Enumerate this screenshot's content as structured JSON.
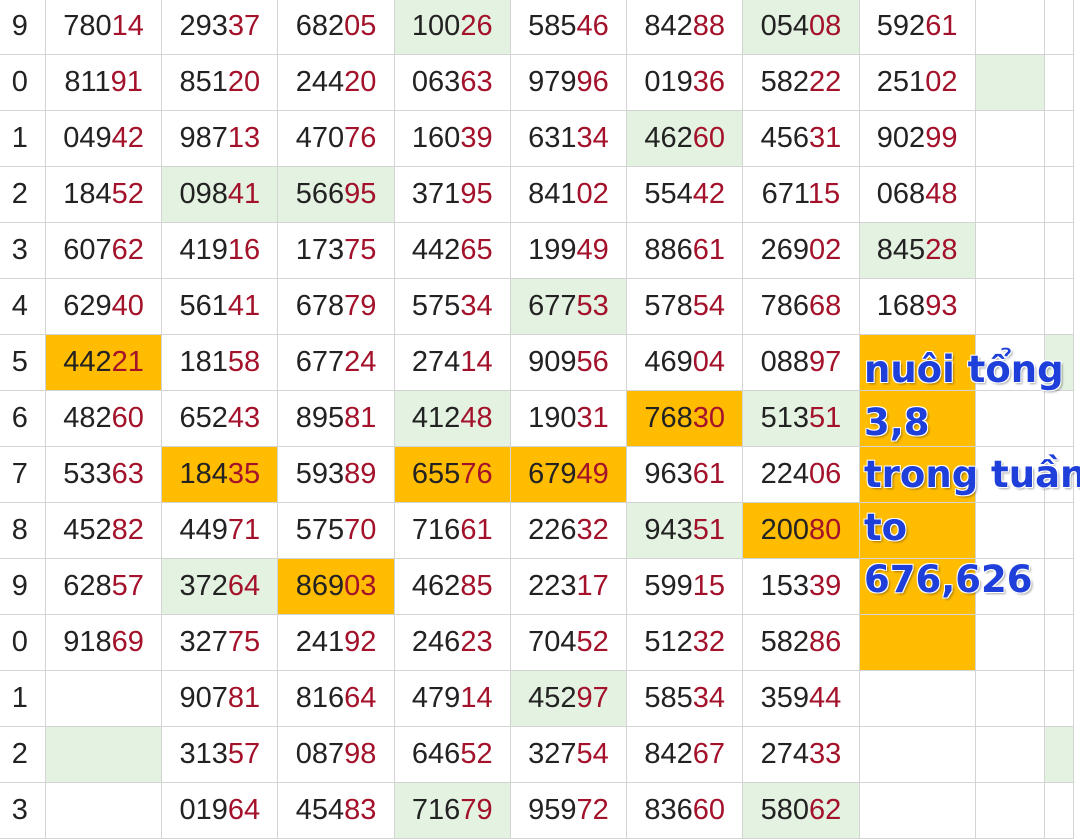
{
  "row_labels": [
    "9",
    "0",
    "1",
    "2",
    "3",
    "4",
    "5",
    "6",
    "7",
    "8",
    "9",
    "0",
    "1",
    "2",
    "3"
  ],
  "rows": [
    [
      [
        "780",
        "14"
      ],
      [
        "293",
        "37"
      ],
      [
        "682",
        "05"
      ],
      [
        "100",
        "26"
      ],
      [
        "585",
        "46"
      ],
      [
        "842",
        "88"
      ],
      [
        "054",
        "08"
      ],
      [
        "592",
        "61"
      ],
      [
        "",
        ""
      ],
      [
        "",
        ""
      ]
    ],
    [
      [
        "811",
        "91"
      ],
      [
        "851",
        "20"
      ],
      [
        "244",
        "20"
      ],
      [
        "063",
        "63"
      ],
      [
        "979",
        "96"
      ],
      [
        "019",
        "36"
      ],
      [
        "582",
        "22"
      ],
      [
        "251",
        "02"
      ],
      [
        "",
        ""
      ],
      [
        "",
        ""
      ]
    ],
    [
      [
        "049",
        "42"
      ],
      [
        "987",
        "13"
      ],
      [
        "470",
        "76"
      ],
      [
        "160",
        "39"
      ],
      [
        "631",
        "34"
      ],
      [
        "462",
        "60"
      ],
      [
        "456",
        "31"
      ],
      [
        "902",
        "99"
      ],
      [
        "",
        ""
      ],
      [
        "",
        ""
      ]
    ],
    [
      [
        "184",
        "52"
      ],
      [
        "098",
        "41"
      ],
      [
        "566",
        "95"
      ],
      [
        "371",
        "95"
      ],
      [
        "841",
        "02"
      ],
      [
        "554",
        "42"
      ],
      [
        "671",
        "15"
      ],
      [
        "068",
        "48"
      ],
      [
        "",
        ""
      ],
      [
        "",
        ""
      ]
    ],
    [
      [
        "607",
        "62"
      ],
      [
        "419",
        "16"
      ],
      [
        "173",
        "75"
      ],
      [
        "442",
        "65"
      ],
      [
        "199",
        "49"
      ],
      [
        "886",
        "61"
      ],
      [
        "269",
        "02"
      ],
      [
        "845",
        "28"
      ],
      [
        "",
        ""
      ],
      [
        "",
        ""
      ]
    ],
    [
      [
        "629",
        "40"
      ],
      [
        "561",
        "41"
      ],
      [
        "678",
        "79"
      ],
      [
        "575",
        "34"
      ],
      [
        "677",
        "53"
      ],
      [
        "578",
        "54"
      ],
      [
        "786",
        "68"
      ],
      [
        "168",
        "93"
      ],
      [
        "",
        ""
      ],
      [
        "",
        ""
      ]
    ],
    [
      [
        "442",
        "21"
      ],
      [
        "181",
        "58"
      ],
      [
        "677",
        "24"
      ],
      [
        "274",
        "14"
      ],
      [
        "909",
        "56"
      ],
      [
        "469",
        "04"
      ],
      [
        "088",
        "97"
      ],
      [
        "",
        ""
      ],
      [
        "",
        ""
      ],
      [
        "",
        ""
      ]
    ],
    [
      [
        "482",
        "60"
      ],
      [
        "652",
        "43"
      ],
      [
        "895",
        "81"
      ],
      [
        "412",
        "48"
      ],
      [
        "190",
        "31"
      ],
      [
        "768",
        "30"
      ],
      [
        "513",
        "51"
      ],
      [
        "",
        ""
      ],
      [
        "",
        ""
      ],
      [
        "",
        ""
      ]
    ],
    [
      [
        "533",
        "63"
      ],
      [
        "184",
        "35"
      ],
      [
        "593",
        "89"
      ],
      [
        "655",
        "76"
      ],
      [
        "679",
        "49"
      ],
      [
        "963",
        "61"
      ],
      [
        "224",
        "06"
      ],
      [
        "",
        ""
      ],
      [
        "",
        ""
      ],
      [
        "",
        ""
      ]
    ],
    [
      [
        "452",
        "82"
      ],
      [
        "449",
        "71"
      ],
      [
        "575",
        "70"
      ],
      [
        "716",
        "61"
      ],
      [
        "226",
        "32"
      ],
      [
        "943",
        "51"
      ],
      [
        "200",
        "80"
      ],
      [
        "",
        ""
      ],
      [
        "",
        ""
      ],
      [
        "",
        ""
      ]
    ],
    [
      [
        "628",
        "57"
      ],
      [
        "372",
        "64"
      ],
      [
        "869",
        "03"
      ],
      [
        "462",
        "85"
      ],
      [
        "223",
        "17"
      ],
      [
        "599",
        "15"
      ],
      [
        "153",
        "39"
      ],
      [
        "",
        ""
      ],
      [
        "",
        ""
      ],
      [
        "",
        ""
      ]
    ],
    [
      [
        "918",
        "69"
      ],
      [
        "327",
        "75"
      ],
      [
        "241",
        "92"
      ],
      [
        "246",
        "23"
      ],
      [
        "704",
        "52"
      ],
      [
        "512",
        "32"
      ],
      [
        "582",
        "86"
      ],
      [
        "",
        ""
      ],
      [
        "",
        ""
      ],
      [
        "",
        ""
      ]
    ],
    [
      [
        "",
        ""
      ],
      [
        "907",
        "81"
      ],
      [
        "816",
        "64"
      ],
      [
        "479",
        "14"
      ],
      [
        "452",
        "97"
      ],
      [
        "585",
        "34"
      ],
      [
        "359",
        "44"
      ],
      [
        "",
        ""
      ],
      [
        "",
        ""
      ],
      [
        "",
        ""
      ]
    ],
    [
      [
        "",
        ""
      ],
      [
        "313",
        "57"
      ],
      [
        "087",
        "98"
      ],
      [
        "646",
        "52"
      ],
      [
        "327",
        "54"
      ],
      [
        "842",
        "67"
      ],
      [
        "274",
        "33"
      ],
      [
        "",
        ""
      ],
      [
        "",
        ""
      ],
      [
        "",
        ""
      ]
    ],
    [
      [
        "",
        ""
      ],
      [
        "019",
        "64"
      ],
      [
        "454",
        "83"
      ],
      [
        "716",
        "79"
      ],
      [
        "959",
        "72"
      ],
      [
        "836",
        "60"
      ],
      [
        "580",
        "62"
      ],
      [
        "",
        ""
      ],
      [
        "",
        ""
      ],
      [
        "",
        ""
      ]
    ]
  ],
  "highlights": {
    "light_green": [
      "0-3",
      "0-6",
      "1-8",
      "2-5",
      "3-1",
      "3-2",
      "4-7",
      "5-4",
      "6-9",
      "7-3",
      "7-6",
      "9-5",
      "10-1",
      "12-4",
      "13-0",
      "13-9",
      "14-3",
      "14-6"
    ],
    "orange": [
      "6-0",
      "7-5",
      "8-1",
      "8-3",
      "8-4",
      "9-6",
      "10-2"
    ]
  },
  "colors": {
    "light_green": "#e3f2e1",
    "orange": "#ffbc00",
    "tail_digits": "#a3122a",
    "row_label": "#2a2acd",
    "note": "#1e3fd9"
  },
  "note": {
    "lines": [
      "nuôi tổng",
      "3,8",
      "trong tuần",
      "to",
      "676,626"
    ]
  }
}
